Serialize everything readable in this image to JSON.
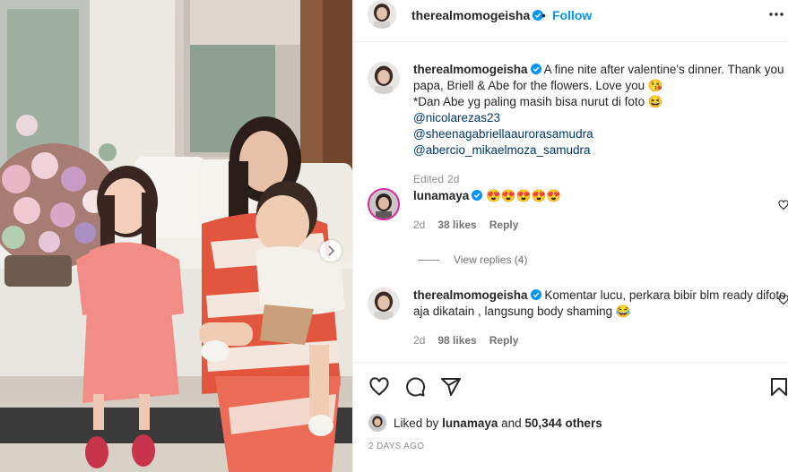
{
  "post": {
    "username": "therealmomogeisha",
    "follow_label": "Follow",
    "dot": "•",
    "caption": {
      "username": "therealmomogeisha",
      "line1": "A fine nite after valentine's dinner. Thank you papa, Briell & Abe for the flowers. Love you 😘",
      "line2": "*Dan Abe yg paling masih bisa nurut di foto 😆",
      "mentions": [
        "@nicolarezas23",
        "@sheenagabriellaaurorasamudra",
        "@abercio_mikaelmoza_samudra"
      ],
      "edited": "Edited",
      "age": "2d"
    }
  },
  "comments": [
    {
      "username": "lunamaya",
      "text": "😍😍😍😍😍",
      "age": "2d",
      "likes": "38 likes",
      "reply": "Reply",
      "view_replies": "View replies (4)"
    },
    {
      "username": "therealmomogeisha",
      "text": "Komentar lucu, perkara bibir blm ready difoto aja dikatain , langsung body shaming 😂",
      "age": "2d",
      "likes": "98 likes",
      "reply": "Reply"
    }
  ],
  "likes_summary": {
    "prefix": "Liked by",
    "user": "lunamaya",
    "and": "and",
    "count": "50,344 others"
  },
  "time_ago": "2 DAYS AGO",
  "colors": {
    "link": "#0095f6",
    "mention": "#00376b",
    "verified": "#0095f6",
    "meta": "#8e8e8e"
  },
  "icons": [
    "next-chevron-icon",
    "verified-badge-icon",
    "more-options-icon",
    "heart-icon",
    "comment-icon",
    "share-icon",
    "bookmark-icon"
  ]
}
